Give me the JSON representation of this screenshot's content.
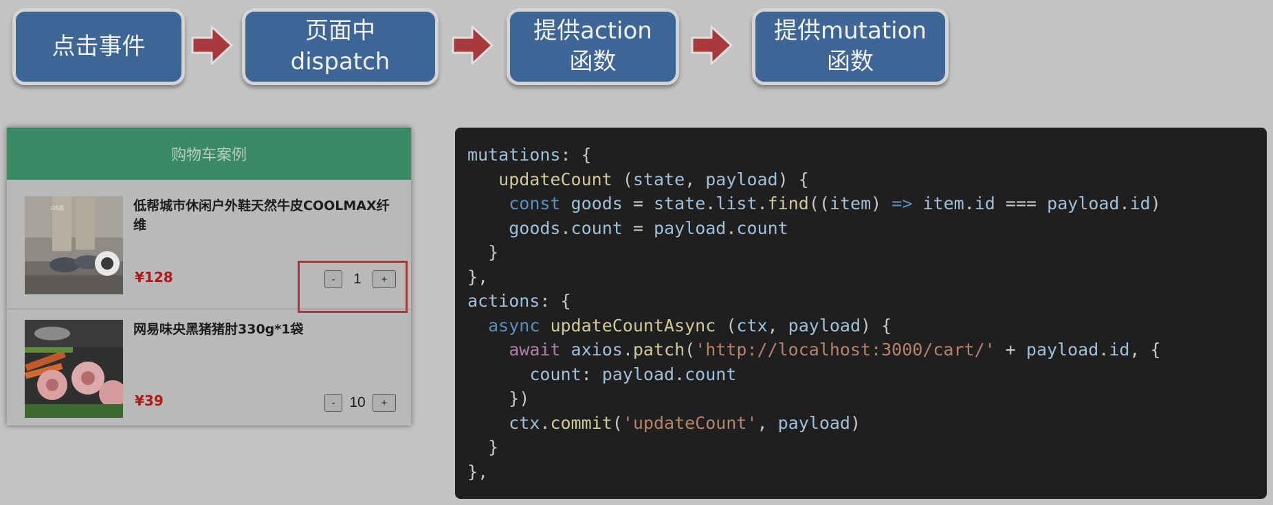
{
  "flow": {
    "steps": [
      {
        "line1": "点击事件",
        "line2": ""
      },
      {
        "line1": "页面中",
        "line2": "dispatch"
      },
      {
        "line1": "提供action",
        "line2": "函数"
      },
      {
        "line1": "提供mutation",
        "line2": "函数"
      }
    ]
  },
  "cart": {
    "title": "购物车案例",
    "items": [
      {
        "name": "低帮城市休闲户外鞋天然牛皮COOLMAX纤维",
        "price": "¥128",
        "count": "1",
        "image_label": "OS思"
      },
      {
        "name": "网易味央黑猪猪肘330g*1袋",
        "price": "¥39",
        "count": "10",
        "image_label": ""
      }
    ],
    "minus_label": "-",
    "plus_label": "+"
  },
  "code": {
    "language": "javascript",
    "lines": [
      "mutations: {",
      "   updateCount (state, payload) {",
      "    const goods = state.list.find((item) => item.id === payload.id)",
      "    goods.count = payload.count",
      "  }",
      "},",
      "actions: {",
      "  async updateCountAsync (ctx, payload) {",
      "    await axios.patch('http://localhost:3000/cart/' + payload.id, {",
      "      count: payload.count",
      "    })",
      "    ctx.commit('updateCount', payload)",
      "  }",
      "},"
    ]
  },
  "colors": {
    "background": "#c3c3c3",
    "flow_box": "#3d6696",
    "flow_arrow": "#a83a3e",
    "cart_header": "#3a8a66",
    "price": "#b01818",
    "highlight": "#a5363a",
    "code_bg": "#1f1f1f"
  }
}
